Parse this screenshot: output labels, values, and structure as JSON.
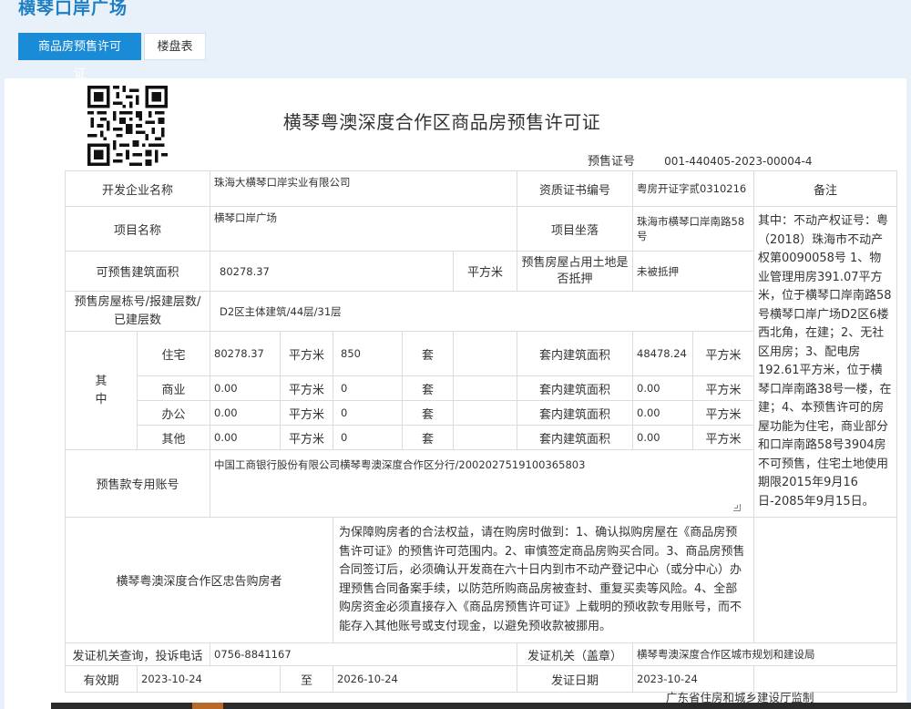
{
  "page": {
    "site_title": "横琴口岸广场",
    "tabs": [
      {
        "label": "商品房预售许可证",
        "active": true
      },
      {
        "label": "楼盘表",
        "active": false
      }
    ]
  },
  "license": {
    "title": "横琴粤澳深度合作区商品房预售许可证",
    "permit_label": "预售证号",
    "permit_no": "001-440405-2023-00004-4",
    "developer_label": "开发企业名称",
    "developer": "珠海大横琴口岸实业有限公司",
    "cert_label": "资质证书编号",
    "cert_no": "粤房开证字贰0310216",
    "remark_label": "备注",
    "project_label": "项目名称",
    "project": "横琴口岸广场",
    "location_label": "项目坐落",
    "location": "珠海市横琴口岸南路58号",
    "area_label": "可预售建筑面积",
    "area": "80278.37",
    "area_unit": "平方米",
    "mortgage_label": "预售房屋占用土地是否抵押",
    "mortgage": "未被抵押",
    "building_label": "预售房屋栋号/报建层数/已建层数",
    "building": "D2区主体建筑/44层/31层",
    "among_label": "其中",
    "unit_sqm": "平方米",
    "unit_set": "套",
    "inner_area_label": "套内建筑面积",
    "rows": [
      {
        "type": "住宅",
        "area": "80278.37",
        "count": "850",
        "inner": "48478.24"
      },
      {
        "type": "商业",
        "area": "0.00",
        "count": "0",
        "inner": "0.00"
      },
      {
        "type": "办公",
        "area": "0.00",
        "count": "0",
        "inner": "0.00"
      },
      {
        "type": "其他",
        "area": "0.00",
        "count": "0",
        "inner": "0.00"
      }
    ],
    "notes": "其中：不动产权证号：粤（2018）珠海市不动产权第0090058号 1、物业管理用房391.07平方米，位于横琴口岸南路58号横琴口岸广场D2区6楼西北角，在建；2、无社区用房；3、配电房192.61平方米，位于横琴口岸南路38号一楼，在建；4、本预售许可的房屋功能为住宅，商业部分和口岸南路58号3904房不可预售，住宅土地使用期限2015年9月16日-2085年9月15日。",
    "account_label": "预售款专用账号",
    "account": "中国工商银行股份有限公司横琴粤澳深度合作区分行/2002027519100365803",
    "warning_label": "横琴粤澳深度合作区忠告购房者",
    "warning": "为保障购房者的合法权益，请在购房时做到：1、确认拟购房屋在《商品房预售许可证》的预售许可范围内。2、审慎签定商品房购买合同。3、商品房预售合同签订后，必须确认开发商在六十日内到市不动产登记中心（或分中心）办理预售合同备案手续，以防范所购商品房被查封、重复买卖等风险。4、全部购房资金必须直接存入《商品房预售许可证》上载明的预收款专用账号，而不能存入其他账号或支付现金，以避免预收款被挪用。",
    "phone_label": "发证机关查询，投诉电话",
    "phone": "0756-8841167",
    "authority_label": "发证机关（盖章）",
    "authority": "横琴粤澳深度合作区城市规划和建设局",
    "valid_label": "有效期",
    "valid_from": "2023-10-24",
    "to_label": "至",
    "valid_to": "2026-10-24",
    "issue_label": "发证日期",
    "issue_date": "2023-10-24"
  },
  "footer": {
    "supervision": "广东省住房和城乡建设厅监制"
  }
}
